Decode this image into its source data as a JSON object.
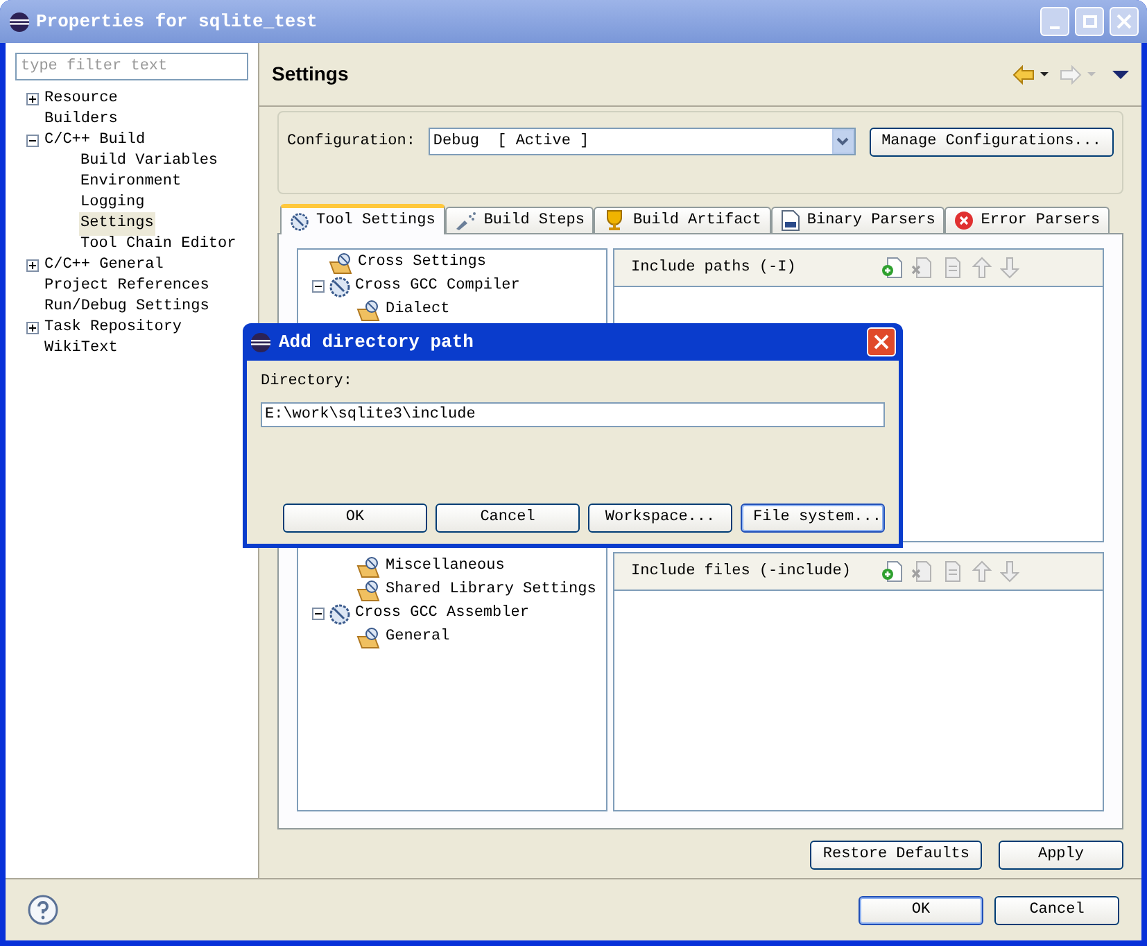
{
  "window": {
    "title": "Properties for sqlite_test"
  },
  "filter": {
    "placeholder": "type filter text"
  },
  "nav_tree": [
    {
      "label": "Resource",
      "expanded": false,
      "selected": false
    },
    {
      "label": "Builders",
      "selected": false
    },
    {
      "label": "C/C++ Build",
      "expanded": true,
      "selected": false,
      "children": [
        {
          "label": "Build Variables",
          "selected": false
        },
        {
          "label": "Environment",
          "selected": false
        },
        {
          "label": "Logging",
          "selected": false
        },
        {
          "label": "Settings",
          "selected": true
        },
        {
          "label": "Tool Chain Editor",
          "selected": false
        }
      ]
    },
    {
      "label": "C/C++ General",
      "expanded": false,
      "selected": false
    },
    {
      "label": "Project References",
      "selected": false
    },
    {
      "label": "Run/Debug Settings",
      "selected": false
    },
    {
      "label": "Task Repository",
      "expanded": false,
      "selected": false
    },
    {
      "label": "WikiText",
      "selected": false
    }
  ],
  "page_title": "Settings",
  "configuration": {
    "label": "Configuration:",
    "value": "Debug  [ Active ]",
    "manage_button": "Manage Configurations..."
  },
  "tabs": [
    {
      "label": "Tool Settings",
      "kind": "tool",
      "selected": true
    },
    {
      "label": "Build Steps",
      "kind": "steps",
      "selected": false
    },
    {
      "label": "Build Artifact",
      "kind": "artifact",
      "selected": false
    },
    {
      "label": "Binary Parsers",
      "kind": "binary",
      "selected": false
    },
    {
      "label": "Error Parsers",
      "kind": "error",
      "selected": false
    }
  ],
  "tool_tree": [
    {
      "label": "Cross Settings",
      "kind": "category"
    },
    {
      "label": "Cross GCC Compiler",
      "kind": "tool",
      "expanded": true,
      "children": [
        {
          "label": "Dialect",
          "kind": "category"
        },
        {
          "label": "Miscellaneous",
          "kind": "category"
        },
        {
          "label": "Shared Library Settings",
          "kind": "category"
        }
      ]
    },
    {
      "label": "Cross GCC Assembler",
      "kind": "tool",
      "expanded": true,
      "children": [
        {
          "label": "General",
          "kind": "category"
        }
      ]
    }
  ],
  "include_paths": {
    "title": "Include paths (-I)"
  },
  "include_files": {
    "title": "Include files (-include)"
  },
  "page_buttons": [
    "Restore Defaults",
    "Apply"
  ],
  "dialog_buttons": [
    "OK",
    "Cancel"
  ],
  "directory_dialog": {
    "title": "Add directory path",
    "label": "Directory:",
    "value": "E:\\work\\sqlite3\\include",
    "buttons": [
      {
        "label": "OK",
        "default": false
      },
      {
        "label": "Cancel",
        "default": false
      },
      {
        "label": "Workspace...",
        "default": false
      },
      {
        "label": "File system...",
        "default": true
      }
    ]
  }
}
